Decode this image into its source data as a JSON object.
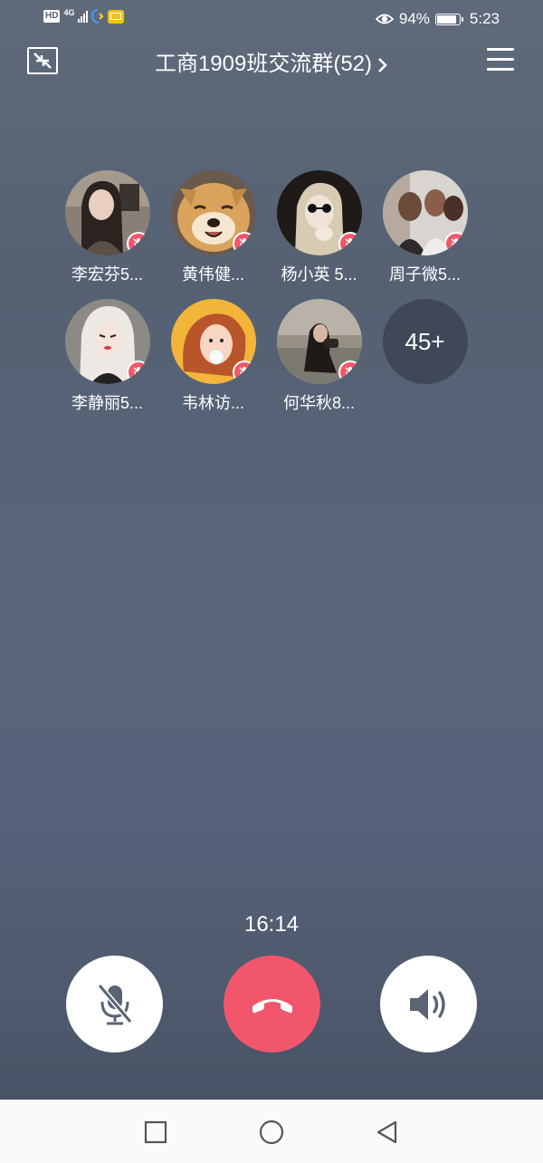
{
  "status_bar": {
    "hd": "HD",
    "network": "4G",
    "battery_percent": "94%",
    "battery_level": 0.94,
    "time": "5:23",
    "icons": [
      "signal-icon",
      "phone-app-icon",
      "mail-app-icon",
      "eye-icon",
      "battery-icon"
    ]
  },
  "header": {
    "title": "工商1909班交流群(52)",
    "left_icon": "minimize-icon",
    "right_icon": "menu-icon"
  },
  "participants": [
    {
      "name": "李宏芬5...",
      "muted": true,
      "avatar": "girl-selfie"
    },
    {
      "name": "黄伟健...",
      "muted": true,
      "avatar": "shiba-dog"
    },
    {
      "name": "杨小英 5...",
      "muted": true,
      "avatar": "girl-sunglasses"
    },
    {
      "name": "周子微5...",
      "muted": true,
      "avatar": "group-photo"
    },
    {
      "name": "李静丽5...",
      "muted": true,
      "avatar": "illustrated-girl"
    },
    {
      "name": "韦林访...",
      "muted": true,
      "avatar": "bubble-girl"
    },
    {
      "name": "何华秋8...",
      "muted": true,
      "avatar": "girl-on-sofa"
    }
  ],
  "more_count": "45+",
  "call": {
    "duration": "16:14",
    "buttons": [
      "mute-microphone",
      "hang-up",
      "speaker"
    ]
  },
  "colors": {
    "accent_red": "#f2566a",
    "background": "#5a6578"
  },
  "nav": [
    "recent-apps",
    "home",
    "back"
  ]
}
